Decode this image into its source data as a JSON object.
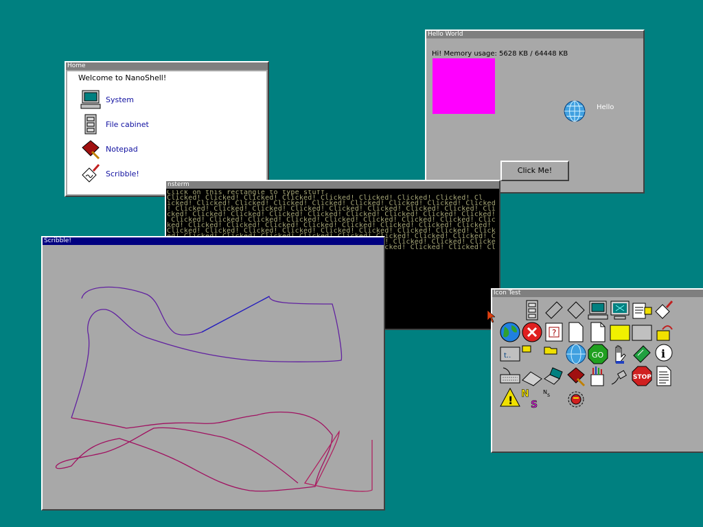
{
  "home": {
    "title": "Home",
    "welcome": "Welcome to NanoShell!",
    "items": [
      {
        "label": "System",
        "icon": "computer-icon"
      },
      {
        "label": "File cabinet",
        "icon": "file-cabinet-icon"
      },
      {
        "label": "Notepad",
        "icon": "notepad-icon"
      },
      {
        "label": "Scribble!",
        "icon": "scribble-icon"
      }
    ]
  },
  "hello": {
    "title": "Hello World",
    "memory_text": "Hi!  Memory usage: 5628 KB / 64448 KB",
    "icon_label": "Hello",
    "button_label": "Click Me!",
    "swatch_color": "#ff00ff"
  },
  "terminal": {
    "title": "nsterm",
    "lines": [
      "Click on this rectangle to type stuff.",
      "Clicked! Clicked! Clicked! Clicked! Clicked! Clicked! Clicked! Clicked! Cl",
      "icked! Clicked! Clicked! Clicked! Clicked! Clicked! Clicked! Clicked! Clicked",
      "! Clicked! Clicked! Clicked! Clicked! Clicked! Clicked! Clicked! Clicked! Cli",
      "cked! Clicked! Clicked! Clicked! Clicked! Clicked! Clicked! Clicked! Clicked!",
      " Clicked! Clicked! Clicked! Clicked! Clicked! Clicked! Clicked! Clicked! Clic",
      "ked! Clicked! Clicked! Clicked! Clicked! Clicked! Clicked! Clicked! Clicked! ",
      "Clicked! Clicked! Clicked! Clicked! Clicked! Clicked! Clicked! Clicked! Click",
      "ed! Clicked! Clicked! Clicked! Clicked! Clicked! Clicked! Clicked! Clicked! C",
      "licked! Clicked! Clicked! Clicked! Clicked! Clicked! Clicked! Clicked! Clicke",
      "d! Clicked! Clicked! Clicked! Clicked! Clicked! Clicked! Clicked! Clicked! Cl"
    ]
  },
  "scribble": {
    "title": "Scribble!"
  },
  "icontest": {
    "title": "Icon Test",
    "icons": [
      "file-cabinet-icon",
      "chip-icon",
      "chip-icon",
      "computer-icon",
      "monitor-icon",
      "notepad-edit-icon",
      "scribble-icon",
      "globe-icon",
      "error-icon",
      "help-file-icon",
      "file-icon",
      "file-icon",
      "folder-yellow-icon",
      "folder-gray-icon",
      "folder-link-icon",
      "folder-parent-icon",
      "folder-small-icon",
      "folder-open-icon",
      "globe-icon",
      "go-icon",
      "hand-icon",
      "book-icon",
      "info-icon",
      "keyboard-icon",
      "keyboard-icon",
      "laptop-icon",
      "notepad-icon",
      "paint-icon",
      "plug-icon",
      "stop-icon",
      "text-file-icon",
      "warning-icon",
      "ns-logo-icon",
      "ns-logo-small-icon",
      "bomb-icon"
    ]
  },
  "colors": {
    "desktop": "#008080",
    "window": "#a8a8a8",
    "inactive_title": "#7f7f7f",
    "active_title": "#000080",
    "link": "#1010a0"
  }
}
